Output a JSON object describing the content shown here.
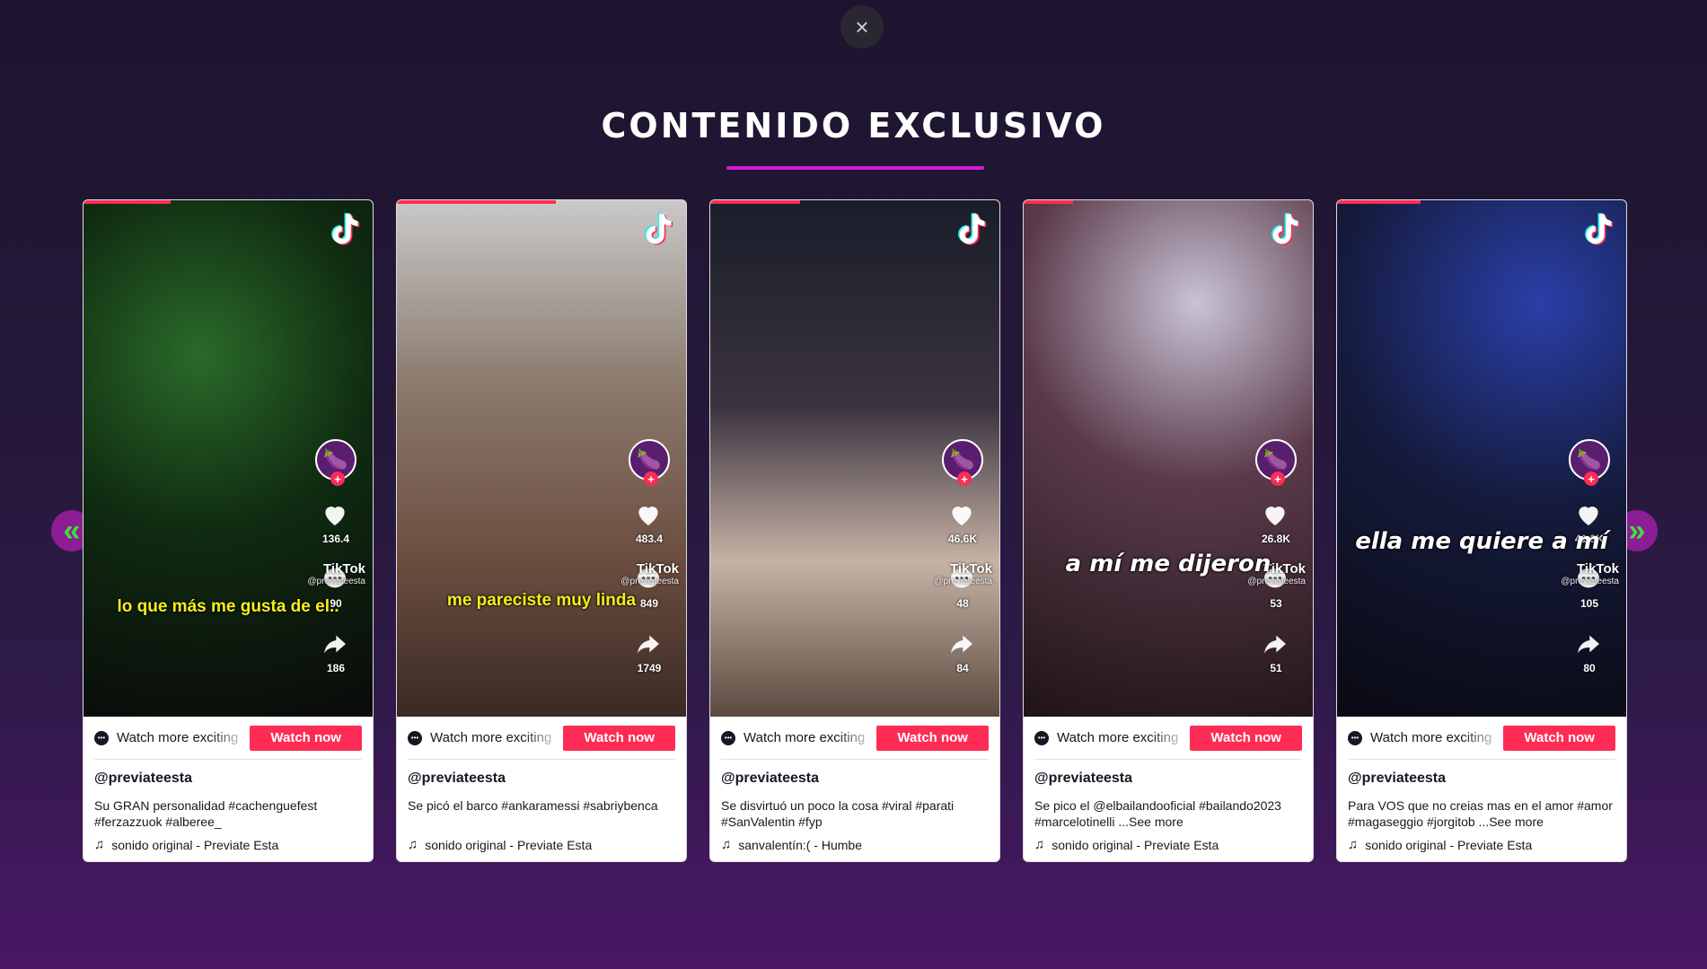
{
  "modal": {
    "close_symbol": "×",
    "title": "CONTENIDO EXCLUSIVO",
    "underline_color": "#d41bd4",
    "nav": {
      "prev_symbol": "«",
      "next_symbol": "»"
    }
  },
  "cards": [
    {
      "progress": 0.3,
      "caption": "lo que más me gusta de el..",
      "caption_style": "yellow",
      "likes": "136.4",
      "comments": "90",
      "shares": "186",
      "watermark_brand": "TikTok",
      "watermark_handle": "@previateesta",
      "watch_text": "Watch more exciting",
      "watch_button": "Watch now",
      "handle": "@previateesta",
      "description": "Su GRAN personalidad #cachenguefest #ferzazzuok #alberee_",
      "music": "sonido original - Previate Esta"
    },
    {
      "progress": 0.55,
      "caption": "me pareciste muy linda",
      "caption_style": "yellow",
      "likes": "483.4",
      "comments": "849",
      "shares": "1749",
      "watermark_brand": "TikTok",
      "watermark_handle": "@previateesta",
      "watch_text": "Watch more exciting",
      "watch_button": "Watch now",
      "handle": "@previateesta",
      "description": "Se picó el barco #ankaramessi #sabriybenca",
      "music": "sonido original - Previate Esta"
    },
    {
      "progress": 0.31,
      "caption": "",
      "caption_style": "white",
      "likes": "46.6K",
      "comments": "48",
      "shares": "84",
      "watermark_brand": "TikTok",
      "watermark_handle": "@previateesta",
      "watch_text": "Watch more exciting",
      "watch_button": "Watch now",
      "handle": "@previateesta",
      "description": "Se disvirtuó un poco la cosa #viral #parati #SanValentin #fyp",
      "music": "sanvalentín:( - Humbe"
    },
    {
      "progress": 0.17,
      "caption": "a mí me dijeron",
      "caption_style": "white",
      "likes": "26.8K",
      "comments": "53",
      "shares": "51",
      "watermark_brand": "TikTok",
      "watermark_handle": "@previateesta",
      "watch_text": "Watch more exciting",
      "watch_button": "Watch now",
      "handle": "@previateesta",
      "description": "Se pico el @elbailandooficial #bailando2023 #marcelotinelli ...See more",
      "music": "sonido original - Previate Esta"
    },
    {
      "progress": 0.29,
      "caption": "ella me quiere a mí",
      "caption_style": "white",
      "likes": "41.9K",
      "comments": "105",
      "shares": "80",
      "watermark_brand": "TikTok",
      "watermark_handle": "@previateesta",
      "watch_text": "Watch more exciting",
      "watch_button": "Watch now",
      "handle": "@previateesta",
      "description": "Para VOS que no creias mas en el amor #amor #magaseggio #jorgitob ...See more",
      "music": "sonido original - Previate Esta"
    }
  ],
  "colors": {
    "tiktok_red": "#fe2c55",
    "arrow_bg": "#8b1e94",
    "arrow_fg": "#3ee03a"
  },
  "icons": {
    "close": "close-icon",
    "tiktok": "tiktok-icon",
    "heart": "heart-icon",
    "comment": "comment-icon",
    "share": "share-icon",
    "music": "music-note-icon",
    "avatar": "eggplant-avatar"
  }
}
